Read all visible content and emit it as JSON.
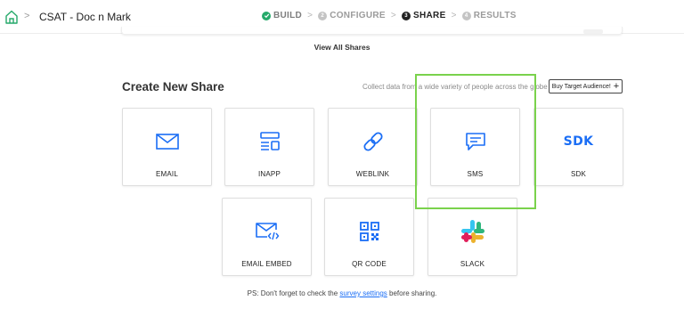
{
  "header": {
    "survey_title": "CSAT - Doc n Mark",
    "breadcrumb_separator": ">",
    "steps": [
      {
        "number": "✓",
        "label": "BUILD",
        "state": "done"
      },
      {
        "number": "2",
        "label": "CONFIGURE",
        "state": "pending"
      },
      {
        "number": "3",
        "label": "SHARE",
        "state": "active"
      },
      {
        "number": "4",
        "label": "RESULTS",
        "state": "pending"
      }
    ],
    "step_arrow": ">",
    "accent_color": "#25a96a"
  },
  "view_all_label": "View All Shares",
  "section": {
    "title": "Create New Share",
    "collect_text": "Collect data from a wide variety of people across the globe",
    "buy_button_label": "Buy Target Audience!",
    "buy_button_icon": "plus-icon"
  },
  "tiles": [
    {
      "id": "email",
      "label": "EMAIL",
      "icon": "envelope-icon"
    },
    {
      "id": "inapp",
      "label": "INAPP",
      "icon": "inapp-layout-icon"
    },
    {
      "id": "weblink",
      "label": "WEBLINK",
      "icon": "link-icon"
    },
    {
      "id": "sms",
      "label": "SMS",
      "icon": "message-icon"
    },
    {
      "id": "sdk",
      "label": "SDK",
      "icon": "sdk-icon",
      "icon_text": "SDK"
    },
    {
      "id": "email-embed",
      "label": "EMAIL EMBED",
      "icon": "envelope-code-icon"
    },
    {
      "id": "qr-code",
      "label": "QR CODE",
      "icon": "qr-code-icon"
    },
    {
      "id": "slack",
      "label": "SLACK",
      "icon": "slack-icon"
    }
  ],
  "icon_color": "#1b6ef5",
  "highlight_color": "#7ad24c",
  "footer": {
    "prefix": "PS: Don't forget to check the ",
    "link": "survey settings",
    "suffix": " before sharing."
  }
}
